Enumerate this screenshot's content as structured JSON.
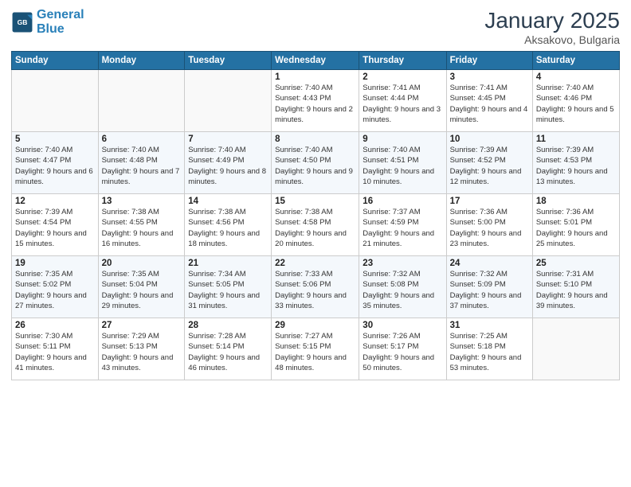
{
  "header": {
    "logo_line1": "General",
    "logo_line2": "Blue",
    "month_year": "January 2025",
    "location": "Aksakovo, Bulgaria"
  },
  "weekdays": [
    "Sunday",
    "Monday",
    "Tuesday",
    "Wednesday",
    "Thursday",
    "Friday",
    "Saturday"
  ],
  "weeks": [
    [
      {
        "day": "",
        "info": ""
      },
      {
        "day": "",
        "info": ""
      },
      {
        "day": "",
        "info": ""
      },
      {
        "day": "1",
        "info": "Sunrise: 7:40 AM\nSunset: 4:43 PM\nDaylight: 9 hours and 2 minutes."
      },
      {
        "day": "2",
        "info": "Sunrise: 7:41 AM\nSunset: 4:44 PM\nDaylight: 9 hours and 3 minutes."
      },
      {
        "day": "3",
        "info": "Sunrise: 7:41 AM\nSunset: 4:45 PM\nDaylight: 9 hours and 4 minutes."
      },
      {
        "day": "4",
        "info": "Sunrise: 7:40 AM\nSunset: 4:46 PM\nDaylight: 9 hours and 5 minutes."
      }
    ],
    [
      {
        "day": "5",
        "info": "Sunrise: 7:40 AM\nSunset: 4:47 PM\nDaylight: 9 hours and 6 minutes."
      },
      {
        "day": "6",
        "info": "Sunrise: 7:40 AM\nSunset: 4:48 PM\nDaylight: 9 hours and 7 minutes."
      },
      {
        "day": "7",
        "info": "Sunrise: 7:40 AM\nSunset: 4:49 PM\nDaylight: 9 hours and 8 minutes."
      },
      {
        "day": "8",
        "info": "Sunrise: 7:40 AM\nSunset: 4:50 PM\nDaylight: 9 hours and 9 minutes."
      },
      {
        "day": "9",
        "info": "Sunrise: 7:40 AM\nSunset: 4:51 PM\nDaylight: 9 hours and 10 minutes."
      },
      {
        "day": "10",
        "info": "Sunrise: 7:39 AM\nSunset: 4:52 PM\nDaylight: 9 hours and 12 minutes."
      },
      {
        "day": "11",
        "info": "Sunrise: 7:39 AM\nSunset: 4:53 PM\nDaylight: 9 hours and 13 minutes."
      }
    ],
    [
      {
        "day": "12",
        "info": "Sunrise: 7:39 AM\nSunset: 4:54 PM\nDaylight: 9 hours and 15 minutes."
      },
      {
        "day": "13",
        "info": "Sunrise: 7:38 AM\nSunset: 4:55 PM\nDaylight: 9 hours and 16 minutes."
      },
      {
        "day": "14",
        "info": "Sunrise: 7:38 AM\nSunset: 4:56 PM\nDaylight: 9 hours and 18 minutes."
      },
      {
        "day": "15",
        "info": "Sunrise: 7:38 AM\nSunset: 4:58 PM\nDaylight: 9 hours and 20 minutes."
      },
      {
        "day": "16",
        "info": "Sunrise: 7:37 AM\nSunset: 4:59 PM\nDaylight: 9 hours and 21 minutes."
      },
      {
        "day": "17",
        "info": "Sunrise: 7:36 AM\nSunset: 5:00 PM\nDaylight: 9 hours and 23 minutes."
      },
      {
        "day": "18",
        "info": "Sunrise: 7:36 AM\nSunset: 5:01 PM\nDaylight: 9 hours and 25 minutes."
      }
    ],
    [
      {
        "day": "19",
        "info": "Sunrise: 7:35 AM\nSunset: 5:02 PM\nDaylight: 9 hours and 27 minutes."
      },
      {
        "day": "20",
        "info": "Sunrise: 7:35 AM\nSunset: 5:04 PM\nDaylight: 9 hours and 29 minutes."
      },
      {
        "day": "21",
        "info": "Sunrise: 7:34 AM\nSunset: 5:05 PM\nDaylight: 9 hours and 31 minutes."
      },
      {
        "day": "22",
        "info": "Sunrise: 7:33 AM\nSunset: 5:06 PM\nDaylight: 9 hours and 33 minutes."
      },
      {
        "day": "23",
        "info": "Sunrise: 7:32 AM\nSunset: 5:08 PM\nDaylight: 9 hours and 35 minutes."
      },
      {
        "day": "24",
        "info": "Sunrise: 7:32 AM\nSunset: 5:09 PM\nDaylight: 9 hours and 37 minutes."
      },
      {
        "day": "25",
        "info": "Sunrise: 7:31 AM\nSunset: 5:10 PM\nDaylight: 9 hours and 39 minutes."
      }
    ],
    [
      {
        "day": "26",
        "info": "Sunrise: 7:30 AM\nSunset: 5:11 PM\nDaylight: 9 hours and 41 minutes."
      },
      {
        "day": "27",
        "info": "Sunrise: 7:29 AM\nSunset: 5:13 PM\nDaylight: 9 hours and 43 minutes."
      },
      {
        "day": "28",
        "info": "Sunrise: 7:28 AM\nSunset: 5:14 PM\nDaylight: 9 hours and 46 minutes."
      },
      {
        "day": "29",
        "info": "Sunrise: 7:27 AM\nSunset: 5:15 PM\nDaylight: 9 hours and 48 minutes."
      },
      {
        "day": "30",
        "info": "Sunrise: 7:26 AM\nSunset: 5:17 PM\nDaylight: 9 hours and 50 minutes."
      },
      {
        "day": "31",
        "info": "Sunrise: 7:25 AM\nSunset: 5:18 PM\nDaylight: 9 hours and 53 minutes."
      },
      {
        "day": "",
        "info": ""
      }
    ]
  ]
}
